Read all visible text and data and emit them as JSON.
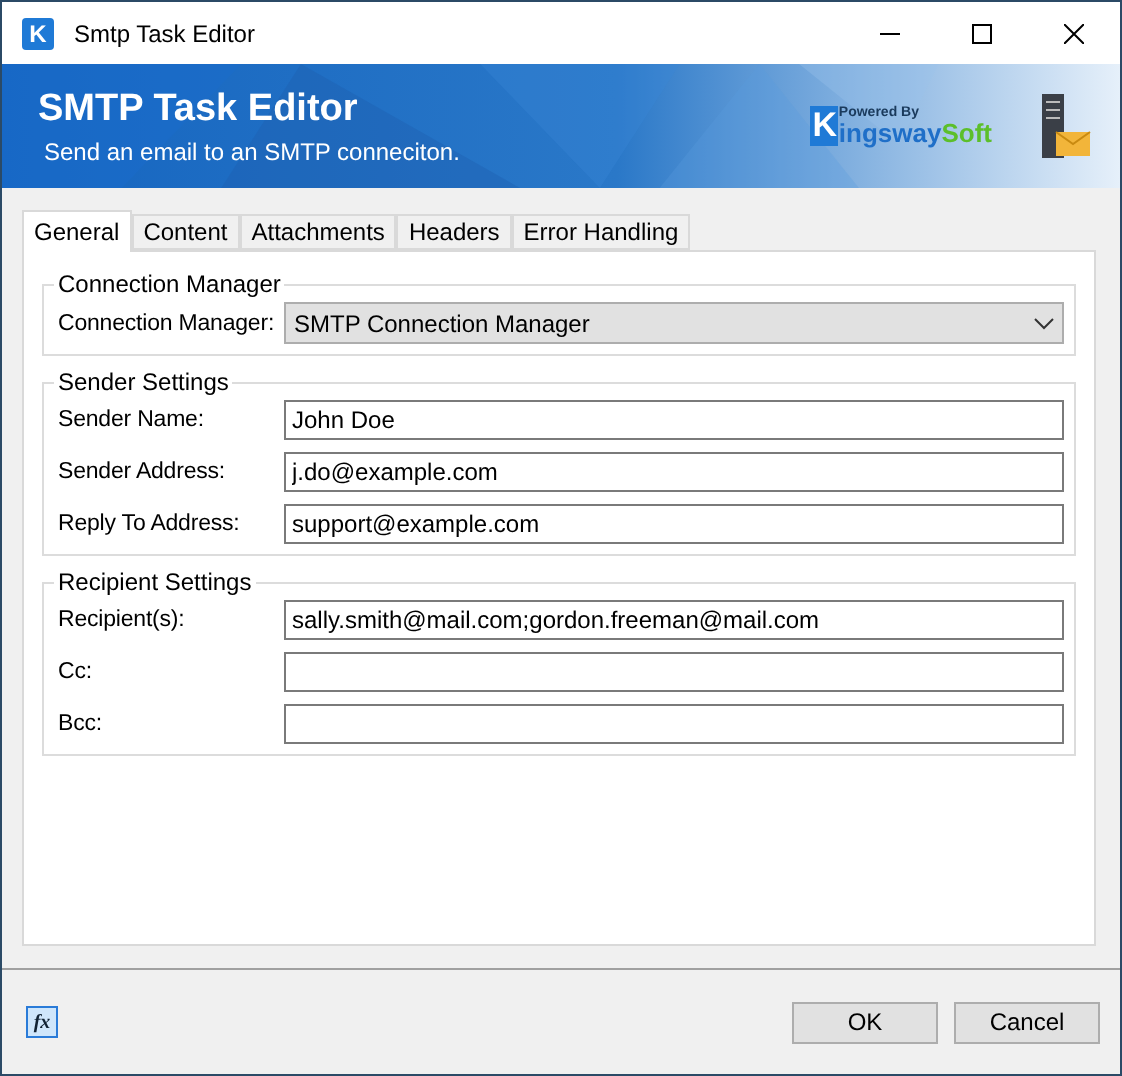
{
  "window": {
    "title": "Smtp Task Editor",
    "app_icon": "K"
  },
  "banner": {
    "title": "SMTP Task Editor",
    "subtitle": "Send an email to an SMTP conneciton.",
    "logo": {
      "powered": "Powered By",
      "k": "K",
      "ingsway": "ingsway",
      "soft": "Soft"
    }
  },
  "tabs": [
    {
      "label": "General",
      "selected": true
    },
    {
      "label": "Content",
      "selected": false
    },
    {
      "label": "Attachments",
      "selected": false
    },
    {
      "label": "Headers",
      "selected": false
    },
    {
      "label": "Error Handling",
      "selected": false
    }
  ],
  "groups": [
    {
      "title": "Connection Manager",
      "fields": [
        {
          "kind": "dropdown",
          "label": "Connection Manager:",
          "value": "SMTP Connection Manager"
        }
      ]
    },
    {
      "title": "Sender Settings",
      "fields": [
        {
          "kind": "text",
          "label": "Sender Name:",
          "value": "John Doe"
        },
        {
          "kind": "text",
          "label": "Sender Address:",
          "value": "j.do@example.com"
        },
        {
          "kind": "text",
          "label": "Reply To Address:",
          "value": "support@example.com"
        }
      ]
    },
    {
      "title": "Recipient Settings",
      "fields": [
        {
          "kind": "text",
          "label": "Recipient(s):",
          "value": "sally.smith@mail.com;gordon.freeman@mail.com"
        },
        {
          "kind": "text",
          "label": "Cc:"
        },
        {
          "kind": "text",
          "label": "Bcc:"
        }
      ]
    }
  ],
  "footer": {
    "expression_button": "fx",
    "buttons": [
      "OK",
      "Cancel"
    ]
  }
}
